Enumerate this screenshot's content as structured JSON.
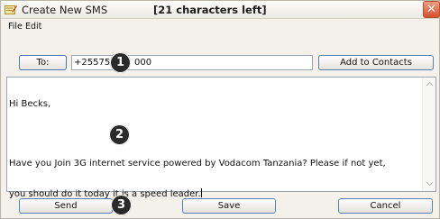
{
  "window": {
    "title": "Create New SMS",
    "chars_left": "[21 characters left]",
    "close_label": "✕",
    "icon": "sms-edit-icon"
  },
  "menu": {
    "items": [
      {
        "label": "File"
      },
      {
        "label": "Edit"
      }
    ]
  },
  "recipient": {
    "to_label": "To:",
    "phone_visible_prefix": "+255",
    "phone_visible_mid": "75",
    "phone_visible_suffix": "000",
    "add_to_contacts_label": "Add to Contacts"
  },
  "message": {
    "lines": [
      "Hi Becks,",
      "",
      "Have you Join 3G internet service powered by Vodacom Tanzania? Please if not yet,",
      "you should do it today it is a speed leader."
    ]
  },
  "actions": {
    "send_label": "Send",
    "save_label": "Save",
    "cancel_label": "Cancel"
  },
  "callouts": {
    "one": "1",
    "two": "2",
    "three": "3"
  },
  "colors": {
    "button_border": "#5a7fb3",
    "close_button": "#d8502c",
    "badge": "#2a2a2a"
  }
}
